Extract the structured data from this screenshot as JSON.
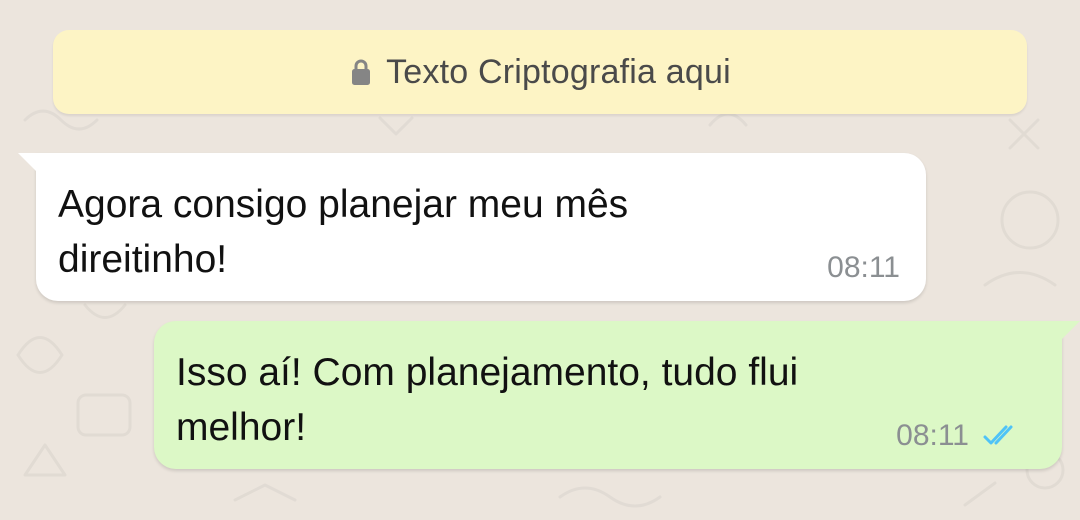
{
  "encryption_notice": {
    "text": "Texto Criptografia aqui",
    "icon": "lock-icon"
  },
  "messages": [
    {
      "direction": "incoming",
      "text": "Agora consigo planejar meu mês direitinho!",
      "time": "08:11"
    },
    {
      "direction": "outgoing",
      "text": "Isso aí! Com planejamento, tudo flui melhor!",
      "time": "08:11",
      "status_icon": "double-check-icon"
    }
  ],
  "colors": {
    "background": "#ece5dd",
    "encryption_banner": "#fdf4c5",
    "incoming_bubble": "#ffffff",
    "outgoing_bubble": "#dcf8c6",
    "read_receipt": "#4fc3f7",
    "timestamp": "#8b8f92"
  }
}
